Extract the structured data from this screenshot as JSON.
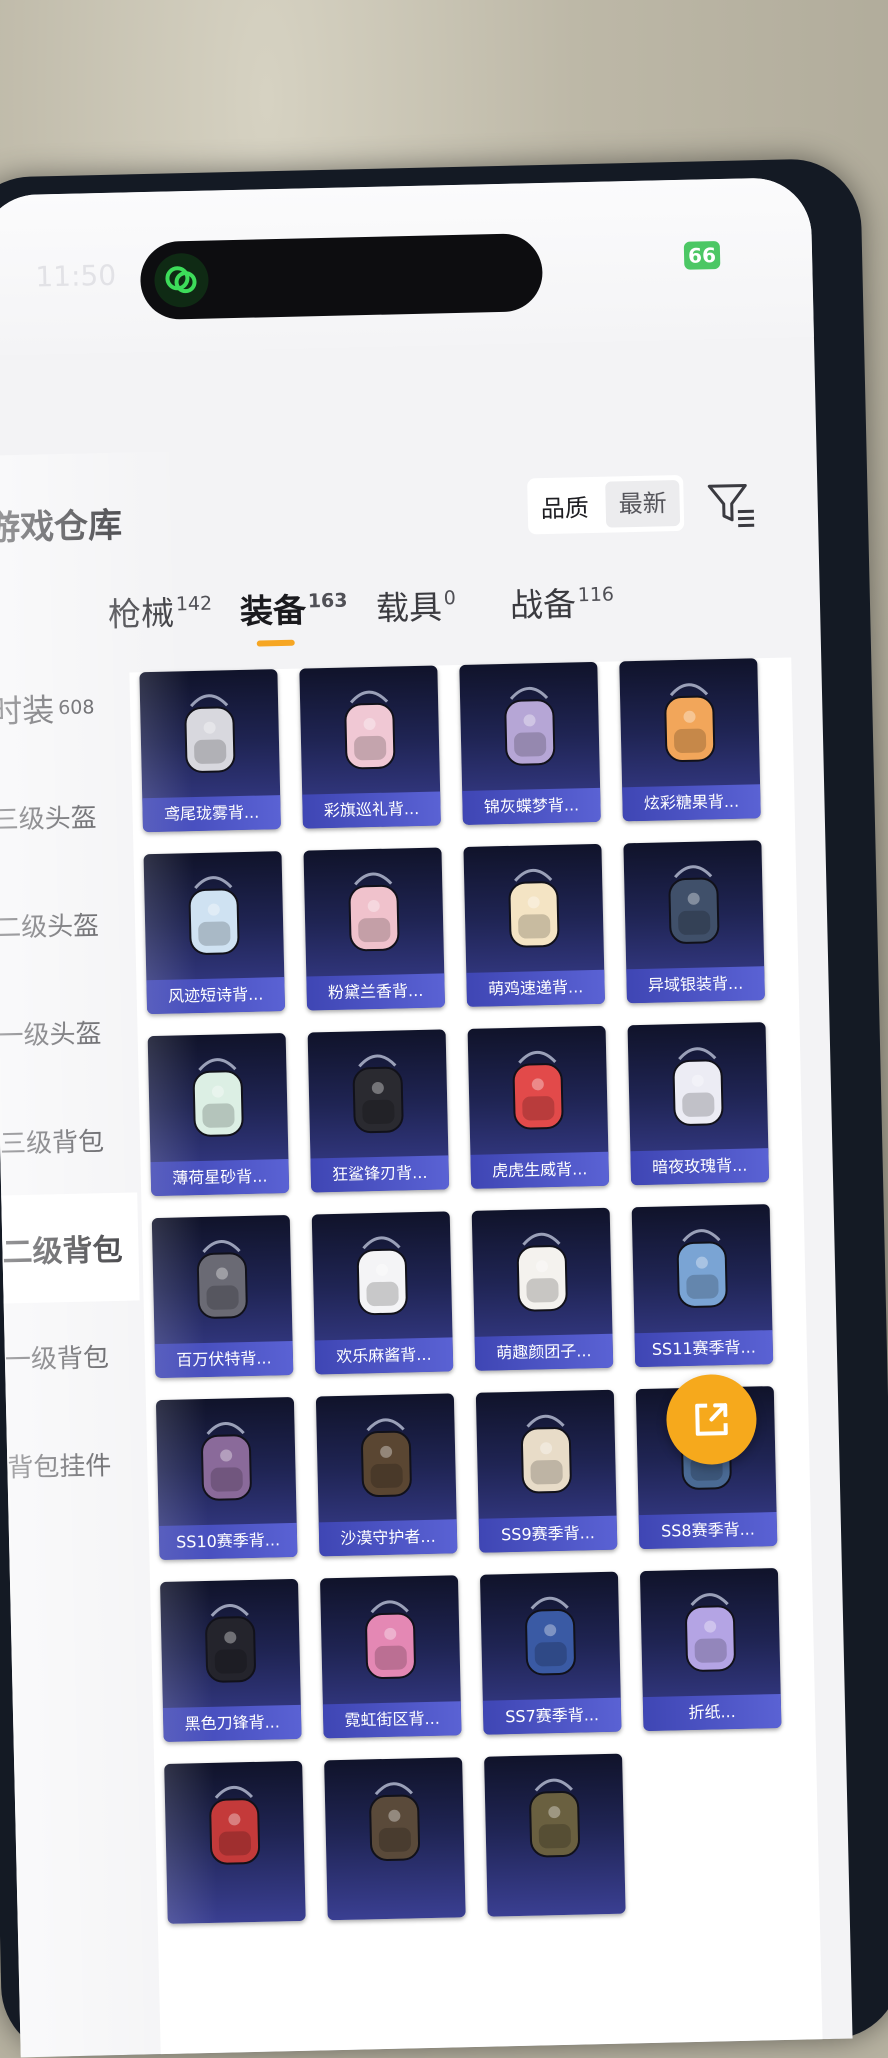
{
  "status": {
    "time": "11:50",
    "battery": "66"
  },
  "header": {
    "title": "游戏仓库",
    "sort_quality": "品质",
    "sort_newest": "最新"
  },
  "tabs": [
    {
      "label": "枪械",
      "count": "142"
    },
    {
      "label": "装备",
      "count": "163"
    },
    {
      "label": "载具",
      "count": "0"
    },
    {
      "label": "战备",
      "count": "116"
    }
  ],
  "sidebar": {
    "head": {
      "label": "时装",
      "count": "608"
    },
    "items": [
      "三级头盔",
      "二级头盔",
      "一级头盔",
      "三级背包",
      "二级背包",
      "一级背包",
      "背包挂件"
    ]
  },
  "items": [
    {
      "name": "鸢尾珑雾背...",
      "color": "#d8d8de"
    },
    {
      "name": "彩旗巡礼背...",
      "color": "#f0c8d4"
    },
    {
      "name": "锦灰蝶梦背...",
      "color": "#b6a6d6"
    },
    {
      "name": "炫彩糖果背...",
      "color": "#f2a65a"
    },
    {
      "name": "风迹短诗背...",
      "color": "#cfe2f2"
    },
    {
      "name": "粉黛兰香背...",
      "color": "#f0c2cc"
    },
    {
      "name": "萌鸡速递背...",
      "color": "#f4e4c4"
    },
    {
      "name": "异域银装背...",
      "color": "#40506a"
    },
    {
      "name": "薄荷星砂背...",
      "color": "#dcefe4"
    },
    {
      "name": "狂鲨锋刃背...",
      "color": "#2a2a30"
    },
    {
      "name": "虎虎生威背...",
      "color": "#e24a4a"
    },
    {
      "name": "暗夜玫瑰背...",
      "color": "#ececf4"
    },
    {
      "name": "百万伏特背...",
      "color": "#6a6a74"
    },
    {
      "name": "欢乐麻酱背...",
      "color": "#f4f4f6"
    },
    {
      "name": "萌趣颜团子...",
      "color": "#f4f2ee"
    },
    {
      "name": "SS11赛季背...",
      "color": "#7aa4d4"
    },
    {
      "name": "SS10赛季背...",
      "color": "#8a6a9a"
    },
    {
      "name": "沙漠守护者...",
      "color": "#5a4632"
    },
    {
      "name": "SS9赛季背...",
      "color": "#e8dcc8"
    },
    {
      "name": "SS8赛季背...",
      "color": "#4a6a94"
    },
    {
      "name": "黑色刀锋背...",
      "color": "#24242c"
    },
    {
      "name": "霓虹街区背...",
      "color": "#e488b4"
    },
    {
      "name": "SS7赛季背...",
      "color": "#3a5aa4"
    },
    {
      "name": "折纸...",
      "color": "#b4a4e4"
    },
    {
      "name": "",
      "color": "#c43a3a"
    },
    {
      "name": "",
      "color": "#5a4a3a"
    },
    {
      "name": "",
      "color": "#6a6040"
    }
  ],
  "colors": {
    "accent": "#f6a623",
    "card_label": "#4a52c4",
    "fab": "#f6a91c"
  },
  "icons": {
    "island": "wechat-logo-icon",
    "filter": "filter-icon",
    "fab": "share-export-icon"
  }
}
